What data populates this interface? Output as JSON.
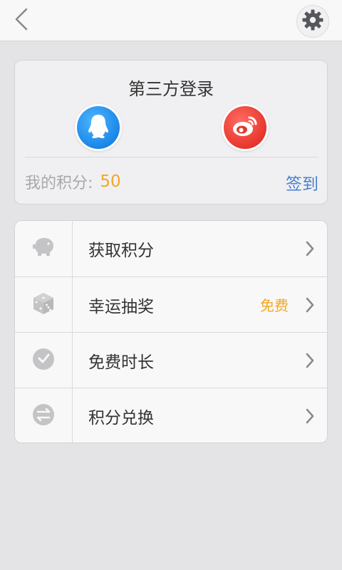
{
  "header": {
    "back_icon": "chevron-left-icon",
    "settings_icon": "gear-icon"
  },
  "login": {
    "title": "第三方登录",
    "providers": [
      {
        "name": "QQ",
        "icon": "qq-penguin-icon",
        "color": "#1a86e8"
      },
      {
        "name": "Weibo",
        "icon": "weibo-eye-icon",
        "color": "#e8362c"
      }
    ],
    "points_label": "我的积分:",
    "points_value": "50",
    "checkin_label": "签到"
  },
  "menu": {
    "items": [
      {
        "label": "获取积分",
        "icon": "piggy-bank-icon",
        "badge": ""
      },
      {
        "label": "幸运抽奖",
        "icon": "dice-icon",
        "badge": "免费"
      },
      {
        "label": "免费时长",
        "icon": "clock-icon",
        "badge": ""
      },
      {
        "label": "积分兑换",
        "icon": "exchange-icon",
        "badge": ""
      }
    ]
  },
  "colors": {
    "accent_orange": "#f5a623",
    "accent_blue": "#4a7fd0",
    "background": "#e4e4e6"
  }
}
